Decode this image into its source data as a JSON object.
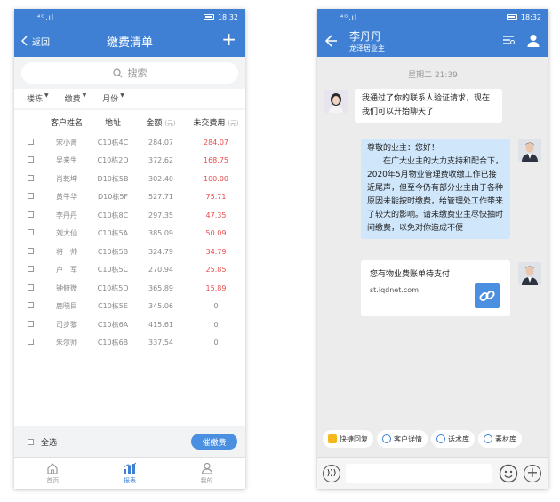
{
  "status": {
    "time": "18:32",
    "signal": "⁴ᴳ.ıl"
  },
  "billing": {
    "back_label": "返回",
    "title": "缴费清单",
    "search_placeholder": "搜索",
    "filters": [
      "楼栋",
      "缴费",
      "月份"
    ],
    "headers": {
      "name": "客户姓名",
      "address": "地址",
      "amount": "金额",
      "amount_unit": "(元)",
      "unpaid": "未交费用",
      "unpaid_unit": "(元)"
    },
    "rows": [
      {
        "name": "宋小菁",
        "address": "C10栋4C",
        "amount": "284.07",
        "unpaid": "284.07"
      },
      {
        "name": "吴来生",
        "address": "C10栋2D",
        "amount": "372.62",
        "unpaid": "168.75"
      },
      {
        "name": "肖乾坤",
        "address": "D10栋5B",
        "amount": "302.40",
        "unpaid": "100.00"
      },
      {
        "name": "黄牛华",
        "address": "D10栋5F",
        "amount": "527.71",
        "unpaid": "75.71"
      },
      {
        "name": "李丹丹",
        "address": "C10栋8C",
        "amount": "297.35",
        "unpaid": "47.35"
      },
      {
        "name": "刘大仙",
        "address": "C10栋5A",
        "amount": "385.09",
        "unpaid": "50.09"
      },
      {
        "name": "将　帅",
        "address": "C10栋5B",
        "amount": "324.79",
        "unpaid": "34.79"
      },
      {
        "name": "卢　军",
        "address": "C10栋5C",
        "amount": "270.94",
        "unpaid": "25.85"
      },
      {
        "name": "钟俯微",
        "address": "C10栋5D",
        "amount": "365.89",
        "unpaid": "15.89"
      },
      {
        "name": "鹿晓目",
        "address": "C10栋5E",
        "amount": "345.06",
        "unpaid": "0"
      },
      {
        "name": "司步黎",
        "address": "C10栋6A",
        "amount": "415.61",
        "unpaid": "0"
      },
      {
        "name": "朱尔师",
        "address": "C10栋6B",
        "amount": "337.54",
        "unpaid": "0"
      }
    ],
    "select_all": "全选",
    "remind_button": "催缴费",
    "tabs": [
      "首页",
      "报表",
      "我的"
    ]
  },
  "chat": {
    "contact_name": "李丹丹",
    "contact_sub": "龙泽居业主",
    "timestamp": "星期二  21:39",
    "incoming": "我通过了你的联系人验证请求，现在我们可以开始聊天了",
    "outgoing_greeting": "尊敬的业主：您好！",
    "outgoing_body": "在广大业主的大力支持和配合下，2020年5月物业管理费收缴工作已接近尾声，但至今仍有部分业主由于各种原因未能按时缴费，给管理处工作带来了较大的影响。请未缴费业主尽快抽时间缴费，以免对你造成不便",
    "card_title": "您有物业费账单待支付",
    "card_url": "st.iqdnet.com",
    "quick_replies": [
      "快捷回复",
      "客户详情",
      "话术库",
      "素材库"
    ],
    "colors": {
      "primary": "#3f80d4",
      "outgoing_bubble": "#cfe6fb",
      "unpaid_red": "#e84b4b"
    }
  }
}
